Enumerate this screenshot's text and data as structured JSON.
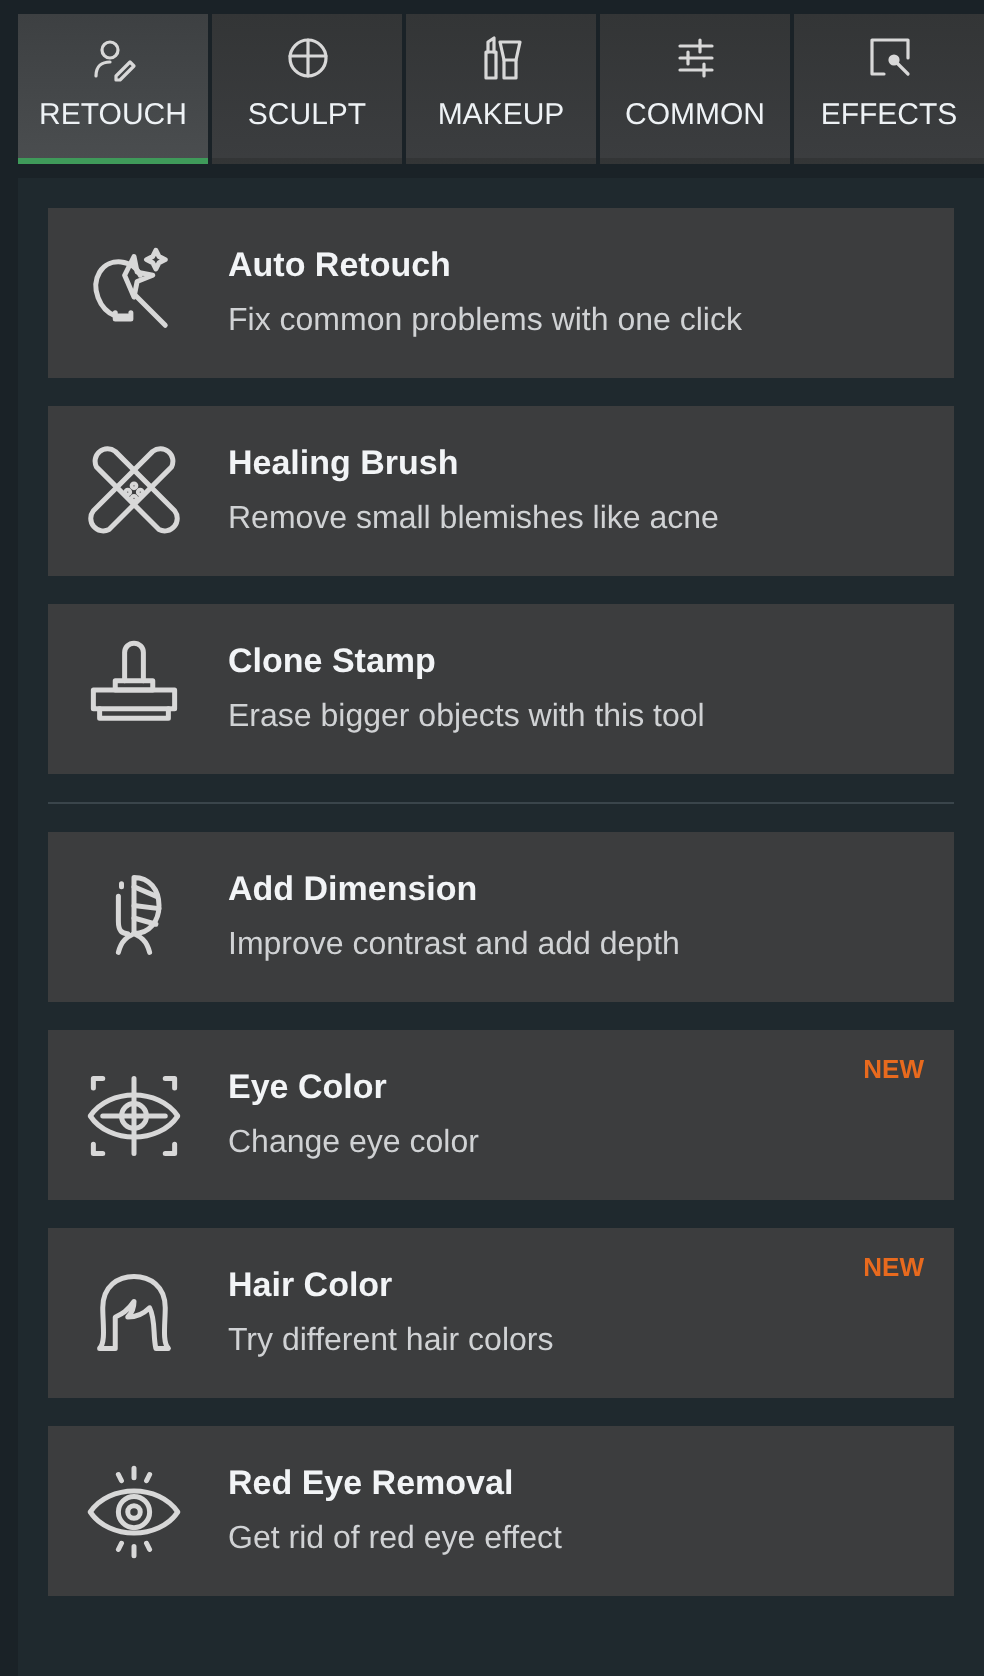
{
  "tabs": [
    {
      "label": "RETOUCH",
      "selected": true
    },
    {
      "label": "SCULPT",
      "selected": false
    },
    {
      "label": "MAKEUP",
      "selected": false
    },
    {
      "label": "COMMON",
      "selected": false
    },
    {
      "label": "EFFECTS",
      "selected": false
    }
  ],
  "groups": [
    {
      "tools": [
        {
          "title": "Auto Retouch",
          "description": "Fix common problems with one click"
        },
        {
          "title": "Healing Brush",
          "description": "Remove small blemishes like acne"
        },
        {
          "title": "Clone Stamp",
          "description": "Erase bigger objects with this tool"
        }
      ]
    },
    {
      "tools": [
        {
          "title": "Add Dimension",
          "description": "Improve contrast and add depth"
        },
        {
          "title": "Eye Color",
          "description": "Change eye color",
          "badge": "NEW"
        },
        {
          "title": "Hair Color",
          "description": "Try different hair colors",
          "badge": "NEW"
        },
        {
          "title": "Red Eye Removal",
          "description": "Get rid of red eye effect"
        }
      ]
    }
  ]
}
